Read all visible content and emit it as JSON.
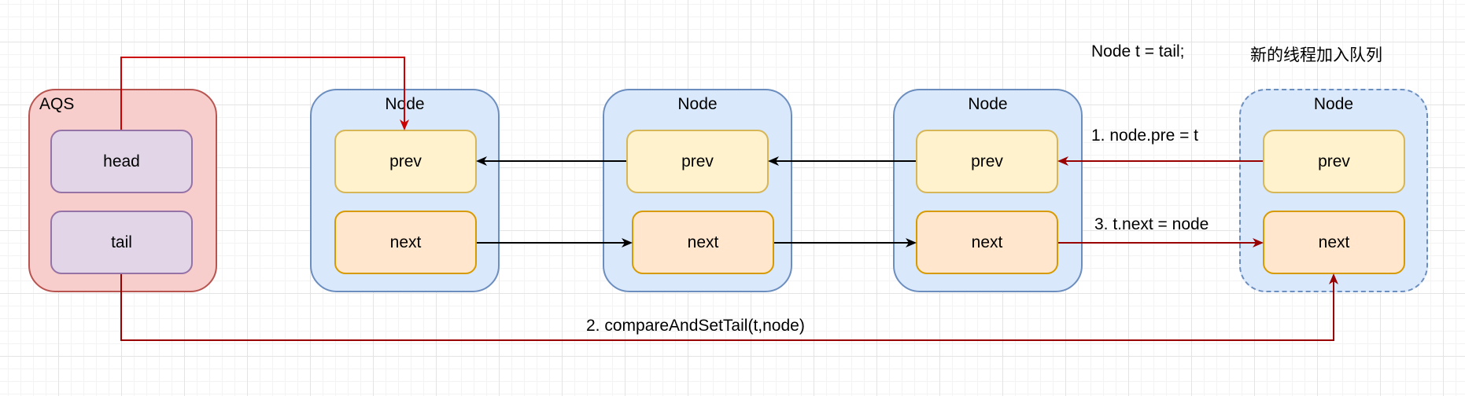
{
  "aqs": {
    "title": "AQS",
    "head": "head",
    "tail": "tail"
  },
  "nodes": [
    {
      "title": "Node",
      "prev": "prev",
      "next": "next"
    },
    {
      "title": "Node",
      "prev": "prev",
      "next": "next"
    },
    {
      "title": "Node",
      "prev": "prev",
      "next": "next"
    },
    {
      "title": "Node",
      "prev": "prev",
      "next": "next"
    }
  ],
  "annotations": {
    "code": "Node t = tail;",
    "caption": "新的线程加入队列",
    "step1": "1. node.pre = t",
    "step2": "2. compareAndSetTail(t,node)",
    "step3": "3. t.next = node"
  },
  "colors": {
    "red_edge": "#cc0000",
    "dark_red_edge": "#990000",
    "black_edge": "#000000"
  }
}
